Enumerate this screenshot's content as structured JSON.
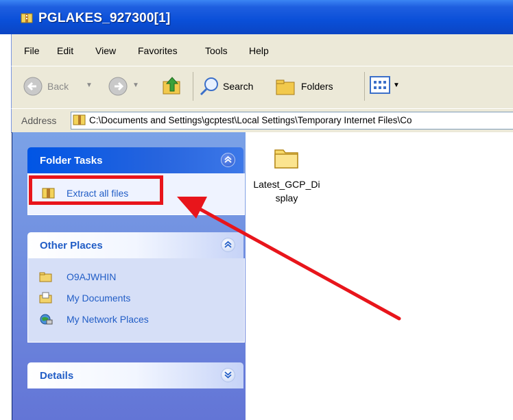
{
  "window": {
    "title": "PGLAKES_927300[1]"
  },
  "menu": {
    "items": [
      "File",
      "Edit",
      "View",
      "Favorites",
      "Tools",
      "Help"
    ]
  },
  "toolbar": {
    "back_label": "Back",
    "search_label": "Search",
    "folders_label": "Folders"
  },
  "address": {
    "label": "Address",
    "value": "C:\\Documents and Settings\\gcptest\\Local Settings\\Temporary Internet Files\\Co"
  },
  "task_pane": {
    "folder_tasks": {
      "title": "Folder Tasks",
      "extract_label": "Extract all files"
    },
    "other_places": {
      "title": "Other Places",
      "items": [
        "O9AJWHIN",
        "My Documents",
        "My Network Places"
      ]
    },
    "details": {
      "title": "Details"
    }
  },
  "content": {
    "file_name_line1": "Latest_GCP_Di",
    "file_name_line2": "splay"
  },
  "colors": {
    "annotation": "#e8151b",
    "link": "#215dc6",
    "titlebar": "#0a4fd8"
  }
}
